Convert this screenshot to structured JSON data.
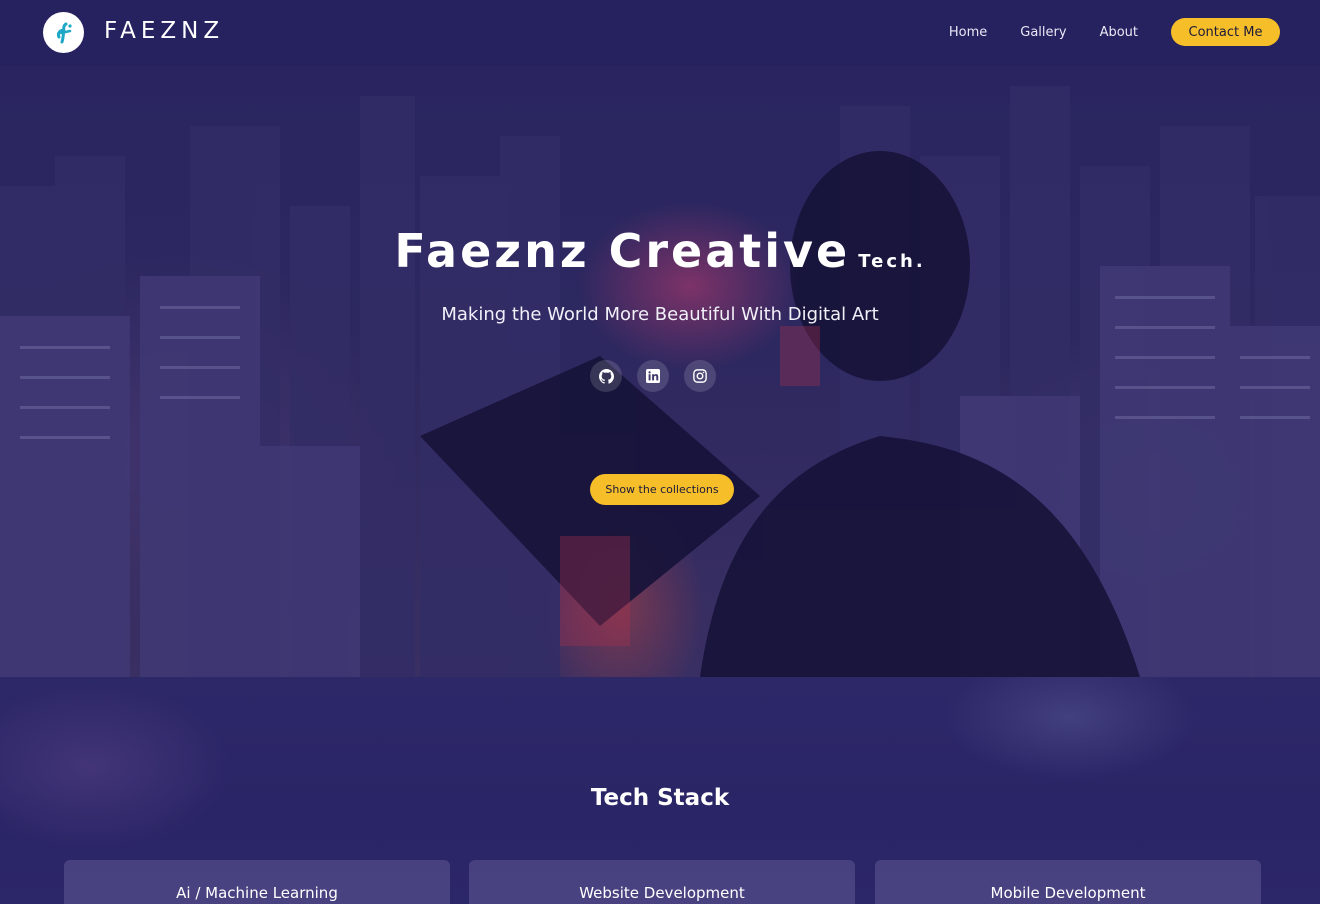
{
  "brand": {
    "name": "FAEZNZ",
    "logo_icon": "faeznz-logo-icon",
    "accent_color": "#f6be28",
    "background_color": "#26215f"
  },
  "nav": {
    "items": [
      {
        "label": "Home"
      },
      {
        "label": "Gallery"
      },
      {
        "label": "About"
      }
    ],
    "contact_label": "Contact Me"
  },
  "hero": {
    "title": "Faeznz Creative",
    "title_suffix": "Tech.",
    "subtitle": "Making the World More Beautiful With Digital Art",
    "socials": [
      {
        "icon": "github-icon"
      },
      {
        "icon": "linkedin-icon"
      },
      {
        "icon": "instagram-icon"
      }
    ],
    "cta_label": "Show the collections"
  },
  "tech_stack": {
    "title": "Tech Stack",
    "cards": [
      {
        "title": "Ai / Machine Learning"
      },
      {
        "title": "Website Development"
      },
      {
        "title": "Mobile Development"
      }
    ]
  }
}
